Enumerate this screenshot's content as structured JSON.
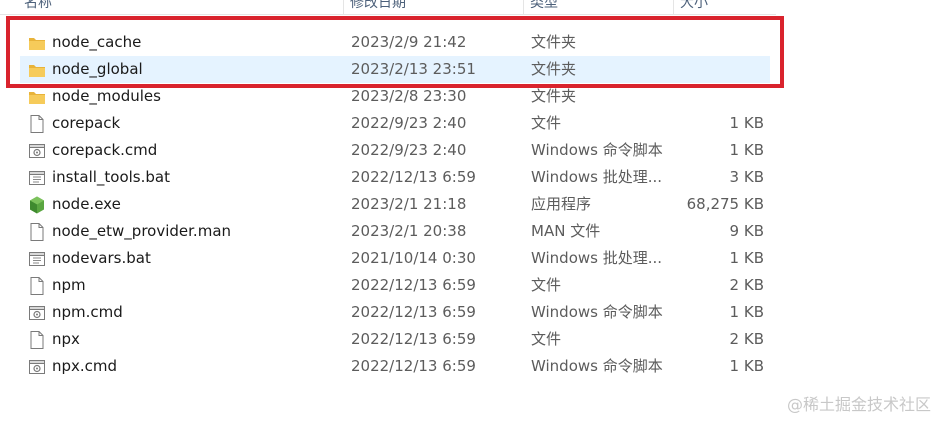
{
  "columns": {
    "name": "名称",
    "date": "修改日期",
    "type": "类型",
    "size": "大小"
  },
  "files": [
    {
      "icon": "folder-icon",
      "name": "node_cache",
      "date": "2023/2/9 21:42",
      "type": "文件夹",
      "size": "",
      "selected": false
    },
    {
      "icon": "folder-icon",
      "name": "node_global",
      "date": "2023/2/13 23:51",
      "type": "文件夹",
      "size": "",
      "selected": true
    },
    {
      "icon": "folder-icon",
      "name": "node_modules",
      "date": "2023/2/8 23:30",
      "type": "文件夹",
      "size": "",
      "selected": false
    },
    {
      "icon": "blank-file-icon",
      "name": "corepack",
      "date": "2022/9/23 2:40",
      "type": "文件",
      "size": "1 KB",
      "selected": false
    },
    {
      "icon": "cmd-script-icon",
      "name": "corepack.cmd",
      "date": "2022/9/23 2:40",
      "type": "Windows 命令脚本",
      "size": "1 KB",
      "selected": false
    },
    {
      "icon": "batch-file-icon",
      "name": "install_tools.bat",
      "date": "2022/12/13 6:59",
      "type": "Windows 批处理...",
      "size": "3 KB",
      "selected": false
    },
    {
      "icon": "nodejs-exe-icon",
      "name": "node.exe",
      "date": "2023/2/1 21:18",
      "type": "应用程序",
      "size": "68,275 KB",
      "selected": false
    },
    {
      "icon": "blank-file-icon",
      "name": "node_etw_provider.man",
      "date": "2023/2/1 20:38",
      "type": "MAN 文件",
      "size": "9 KB",
      "selected": false
    },
    {
      "icon": "batch-file-icon",
      "name": "nodevars.bat",
      "date": "2021/10/14 0:30",
      "type": "Windows 批处理...",
      "size": "1 KB",
      "selected": false
    },
    {
      "icon": "blank-file-icon",
      "name": "npm",
      "date": "2022/12/13 6:59",
      "type": "文件",
      "size": "2 KB",
      "selected": false
    },
    {
      "icon": "cmd-script-icon",
      "name": "npm.cmd",
      "date": "2022/12/13 6:59",
      "type": "Windows 命令脚本",
      "size": "1 KB",
      "selected": false
    },
    {
      "icon": "blank-file-icon",
      "name": "npx",
      "date": "2022/12/13 6:59",
      "type": "文件",
      "size": "2 KB",
      "selected": false
    },
    {
      "icon": "cmd-script-icon",
      "name": "npx.cmd",
      "date": "2022/12/13 6:59",
      "type": "Windows 命令脚本",
      "size": "1 KB",
      "selected": false
    }
  ],
  "watermark": "@稀土掘金技术社区",
  "colors": {
    "highlight_box": "#d9232d",
    "selected_row": "#e5f3ff",
    "folder": "#f3c24f",
    "node_green": "#5aa641"
  }
}
